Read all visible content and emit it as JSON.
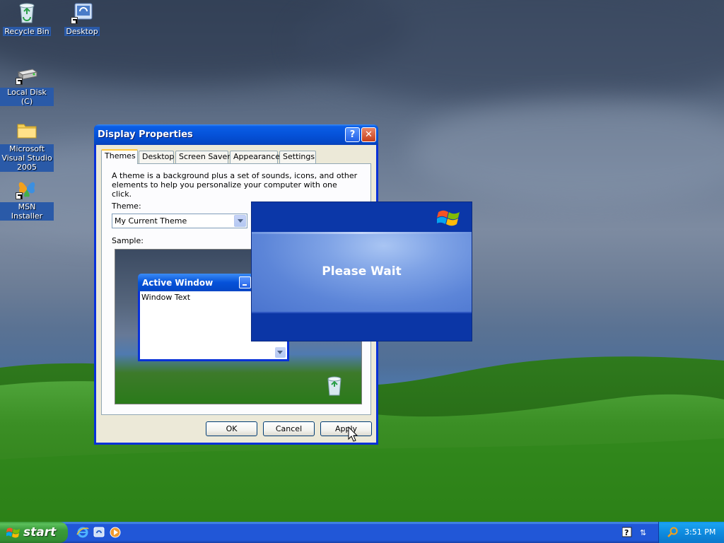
{
  "desktop": {
    "icons": [
      {
        "label": "Recycle Bin",
        "icon": "recycle-bin-icon"
      },
      {
        "label": "Desktop",
        "icon": "desktop-shortcut-icon"
      },
      {
        "label": "Local Disk (C)",
        "icon": "hard-drive-icon"
      },
      {
        "label": "Microsoft Visual Studio 2005",
        "icon": "folder-icon"
      },
      {
        "label": "MSN Installer",
        "icon": "msn-butterfly-icon"
      }
    ]
  },
  "window": {
    "title": "Display Properties",
    "tabs": [
      "Themes",
      "Desktop",
      "Screen Saver",
      "Appearance",
      "Settings"
    ],
    "active_tab": "Themes",
    "description": "A theme is a background plus a set of sounds, icons, and other elements to help you personalize your computer with one click.",
    "theme_label": "Theme:",
    "theme_value": "My Current Theme",
    "sample_label": "Sample:",
    "preview": {
      "window_title": "Active Window",
      "window_text": "Window Text"
    },
    "buttons": {
      "ok": "OK",
      "cancel": "Cancel",
      "apply": "Apply"
    }
  },
  "splash": {
    "message": "Please Wait"
  },
  "taskbar": {
    "start_label": "start",
    "clock": "3:51 PM",
    "colors": {
      "start": "#3a9b3a",
      "bar": "#2157d7",
      "tray": "#0f8ce0"
    }
  }
}
